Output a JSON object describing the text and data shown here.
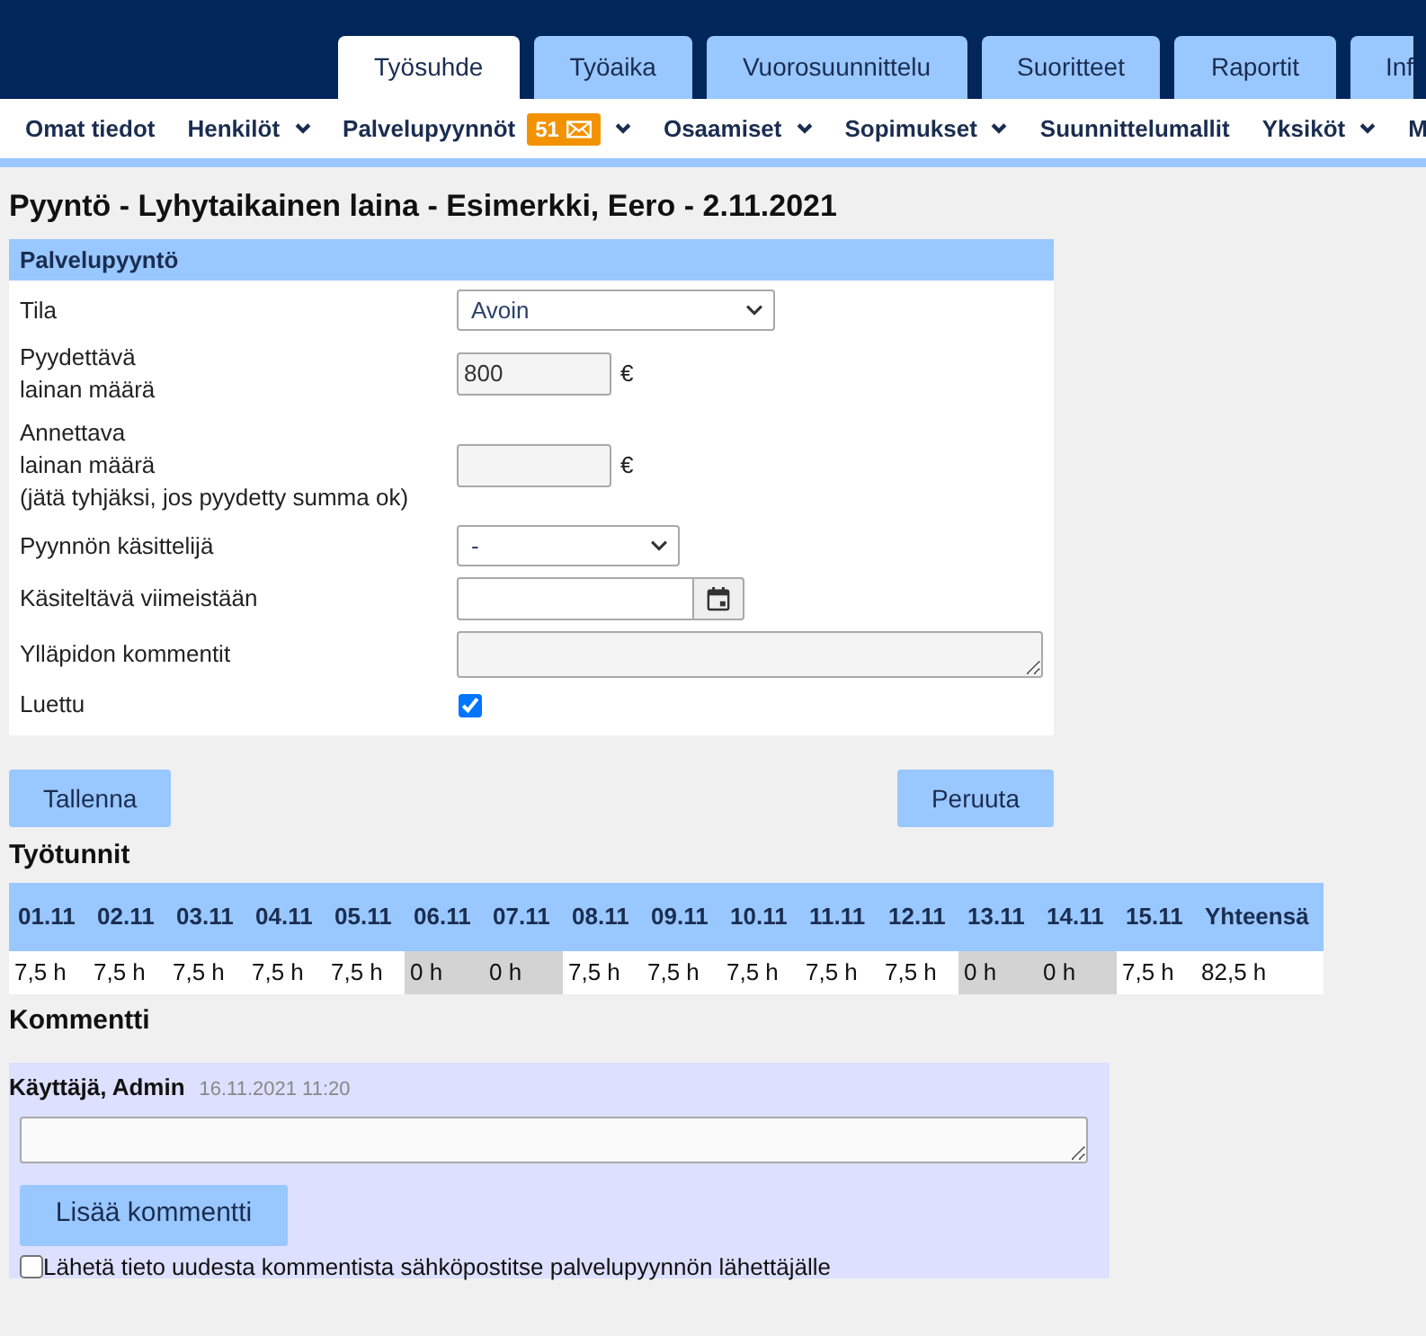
{
  "top_tabs": [
    {
      "label": "Työsuhde",
      "selected": true
    },
    {
      "label": "Työaika",
      "selected": false
    },
    {
      "label": "Vuorosuunnittelu",
      "selected": false
    },
    {
      "label": "Suoritteet",
      "selected": false
    },
    {
      "label": "Raportit",
      "selected": false
    },
    {
      "label": "Inf",
      "selected": false
    }
  ],
  "nav_menu": [
    {
      "label": "Omat tiedot",
      "dropdown": false
    },
    {
      "label": "Henkilöt",
      "dropdown": true
    },
    {
      "label": "Palvelupyynnöt",
      "badge": "51",
      "dropdown": true
    },
    {
      "label": "Osaamiset",
      "dropdown": true
    },
    {
      "label": "Sopimukset",
      "dropdown": true
    },
    {
      "label": "Suunnittelumallit",
      "dropdown": false
    },
    {
      "label": "Yksiköt",
      "dropdown": true
    },
    {
      "label": "M",
      "dropdown": false
    }
  ],
  "page_title": "Pyyntö - Lyhytaikainen laina - Esimerkki, Eero - 2.11.2021",
  "service_request": {
    "title": "Palvelupyyntö",
    "fields": [
      {
        "kind": "select",
        "label": "Tila",
        "value": "Avoin"
      },
      {
        "kind": "amount",
        "label": "Pyydettävä\nlainan määrä",
        "value": "800",
        "unit": "€"
      },
      {
        "kind": "amount",
        "label": "Annettava\nlainan määrä\n(jätä tyhjäksi, jos pyydetty summa ok)",
        "unit": "€"
      },
      {
        "kind": "select",
        "label": "Pyynnön käsittelijä",
        "value": "-"
      },
      {
        "kind": "date",
        "label": "Käsiteltävä viimeistään"
      },
      {
        "kind": "textarea",
        "label": "Ylläpidon kommentit"
      },
      {
        "kind": "checkbox",
        "label": "Luettu",
        "checked": true
      }
    ]
  },
  "buttons": [
    "Tallenna",
    "Peruuta"
  ],
  "work_hours": {
    "title": "Työtunnit",
    "columns": [
      "01.11",
      "02.11",
      "03.11",
      "04.11",
      "05.11",
      "06.11",
      "07.11",
      "08.11",
      "09.11",
      "10.11",
      "11.11",
      "12.11",
      "13.11",
      "14.11",
      "15.11",
      "Yhteensä"
    ],
    "cells": [
      {
        "text": "7,5 h",
        "weekend": false
      },
      {
        "text": "7,5 h",
        "weekend": false
      },
      {
        "text": "7,5 h",
        "weekend": false
      },
      {
        "text": "7,5 h",
        "weekend": false
      },
      {
        "text": "7,5 h",
        "weekend": false
      },
      {
        "text": "0 h",
        "weekend": true
      },
      {
        "text": "0 h",
        "weekend": true
      },
      {
        "text": "7,5 h",
        "weekend": false
      },
      {
        "text": "7,5 h",
        "weekend": false
      },
      {
        "text": "7,5 h",
        "weekend": false
      },
      {
        "text": "7,5 h",
        "weekend": false
      },
      {
        "text": "7,5 h",
        "weekend": false
      },
      {
        "text": "0 h",
        "weekend": true
      },
      {
        "text": "0 h",
        "weekend": true
      },
      {
        "text": "7,5 h",
        "weekend": false
      },
      {
        "text": "82,5 h",
        "weekend": false
      }
    ]
  },
  "comments": {
    "title": "Kommentti",
    "author": "Käyttäjä, Admin",
    "timestamp": "16.11.2021 11:20",
    "add_button": "Lisää kommentti",
    "notify": {
      "label": "Lähetä tieto uudesta kommentista sähköpostitse palvelupyynnön lähettäjälle",
      "checked": false
    }
  }
}
